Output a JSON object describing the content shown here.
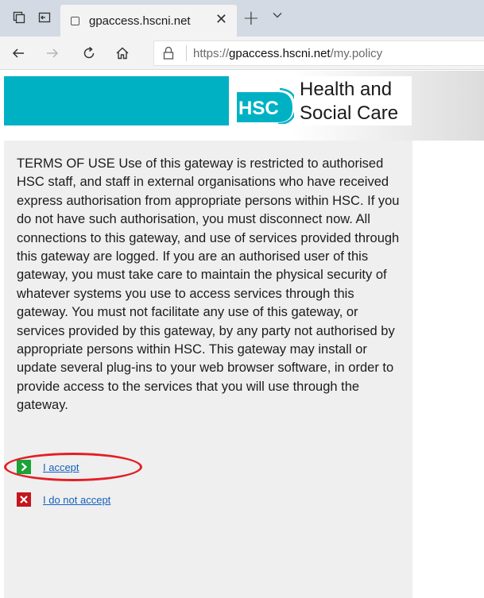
{
  "browser": {
    "tab": {
      "title": "gpaccess.hscni.net"
    },
    "address": {
      "scheme": "https://",
      "host": "gpaccess.hscni.net",
      "path": "/my.policy"
    }
  },
  "banner": {
    "logo_badge": "HSC",
    "logo_line1": "Health and",
    "logo_line2": "Social Care",
    "colors": {
      "teal": "#00b1c4",
      "badge": "#00b1c4"
    }
  },
  "terms": {
    "text": "TERMS OF USE Use of this gateway is restricted to authorised HSC staff, and staff in external organisations who have received express authorisation from appropriate persons within HSC. If you do not have such authorisation, you must disconnect now. All connections to this gateway, and use of services provided through this gateway are logged. If you are an authorised user of this gateway, you must take care to maintain the physical security of whatever systems you use to access services through this gateway. You must not facilitate any use of this gateway, or services provided by this gateway, by any party not authorised by appropriate persons within HSC. This gateway may install or update several plug-ins to your web browser software, in order to provide access to the services that you will use through the gateway."
  },
  "choices": {
    "accept": {
      "label": "I accept",
      "icon": "chevron-right-icon",
      "color": "#1aa337"
    },
    "reject": {
      "label": "I do not accept",
      "icon": "x-icon",
      "color": "#c4161c"
    }
  },
  "annotation": {
    "color": "#e41e26"
  }
}
